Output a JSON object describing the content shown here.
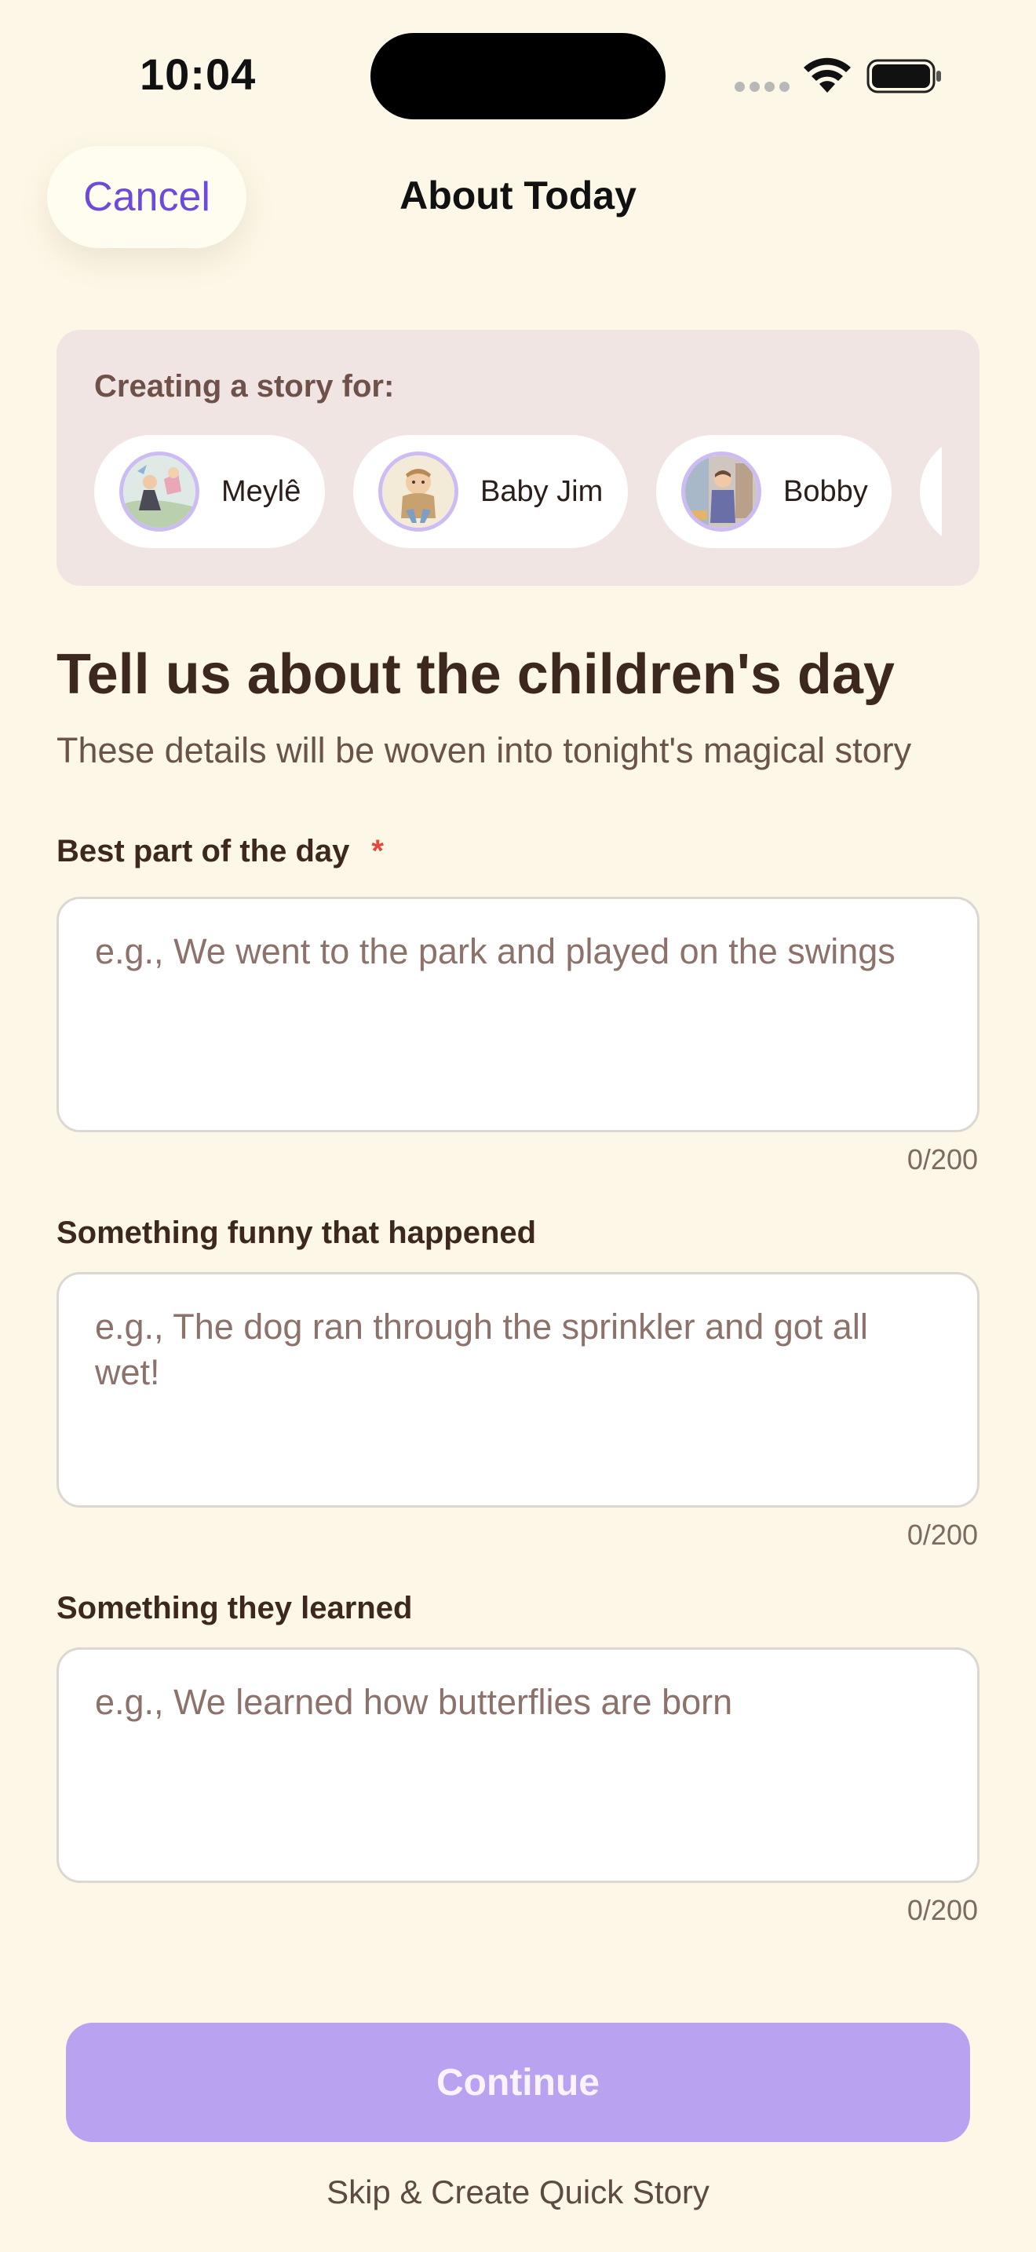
{
  "status_bar": {
    "time": "10:04"
  },
  "nav": {
    "cancel_label": "Cancel",
    "title": "About Today",
    "accent_color": "#6e4ad8"
  },
  "story_for": {
    "label": "Creating a story for:",
    "children": [
      {
        "name": "Meylê"
      },
      {
        "name": "Baby Jim"
      },
      {
        "name": "Bobby"
      }
    ]
  },
  "heading": {
    "title": "Tell us about the children's day",
    "subtitle": "These details will be woven into tonight's magical story"
  },
  "fields": [
    {
      "label": "Best part of the day",
      "required_mark": "*",
      "placeholder": "e.g., We went to the park and played on the swings",
      "counter": "0/200"
    },
    {
      "label": "Something funny that happened",
      "placeholder": "e.g., The dog ran through the sprinkler and got all wet!",
      "counter": "0/200"
    },
    {
      "label": "Something they learned",
      "placeholder": "e.g., We learned how butterflies are born",
      "counter": "0/200"
    }
  ],
  "actions": {
    "continue_label": "Continue",
    "continue_color": "#b9a3f1",
    "skip_label": "Skip & Create Quick Story"
  },
  "icons": [
    "wifi-icon",
    "battery-icon",
    "signal-dots-icon"
  ]
}
